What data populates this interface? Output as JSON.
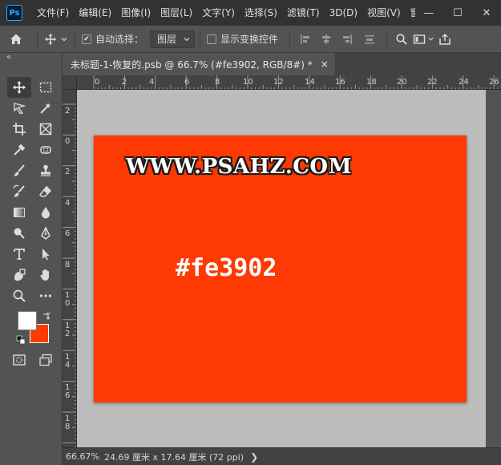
{
  "app": {
    "logo": "Ps"
  },
  "menu": [
    "文件(F)",
    "编辑(E)",
    "图像(I)",
    "图层(L)",
    "文字(Y)",
    "选择(S)",
    "滤镜(T)",
    "3D(D)",
    "视图(V)",
    "窗口(W)"
  ],
  "window_controls": {
    "minimize": "—",
    "maximize": "☐",
    "close": "✕"
  },
  "options": {
    "auto_select_checked": true,
    "auto_select_label": "自动选择：",
    "auto_select_target": "图层",
    "show_transform_label": "显示变换控件",
    "show_transform_checked": false
  },
  "document": {
    "tab_title": "未标题-1-恢复的.psb @ 66.7% (#fe3902, RGB/8#) *",
    "close": "×"
  },
  "ruler_top": [
    "0",
    "2",
    "4",
    "6",
    "8",
    "10",
    "12",
    "14",
    "16",
    "18",
    "20",
    "22",
    "24",
    "26"
  ],
  "ruler_left": [
    "2",
    "0",
    "2",
    "4",
    "6",
    "8",
    "1\n0",
    "1\n2",
    "1\n4",
    "1\n6",
    "1\n8"
  ],
  "canvas": {
    "background": "#fe3902",
    "url_text": "WWW.PSAHZ.COM",
    "hex_text": "#fe3902"
  },
  "colors": {
    "foreground": "#ffffff",
    "background": "#fe3902"
  },
  "status": {
    "zoom": "66.67%",
    "doc_info": "24.69 厘米 x 17.64 厘米 (72 ppi)",
    "arrow": "❯"
  },
  "tools": [
    "move-tool",
    "marquee-tool",
    "lasso-tool",
    "magic-wand-tool",
    "crop-tool",
    "frame-tool",
    "eyedropper-tool",
    "spot-healing-tool",
    "brush-tool",
    "stamp-tool",
    "history-brush-tool",
    "eraser-tool",
    "gradient-tool",
    "blur-tool",
    "dodge-tool",
    "pen-tool",
    "type-tool",
    "path-selection-tool",
    "shape-tool",
    "hand-tool",
    "zoom-tool",
    "more-tools"
  ]
}
